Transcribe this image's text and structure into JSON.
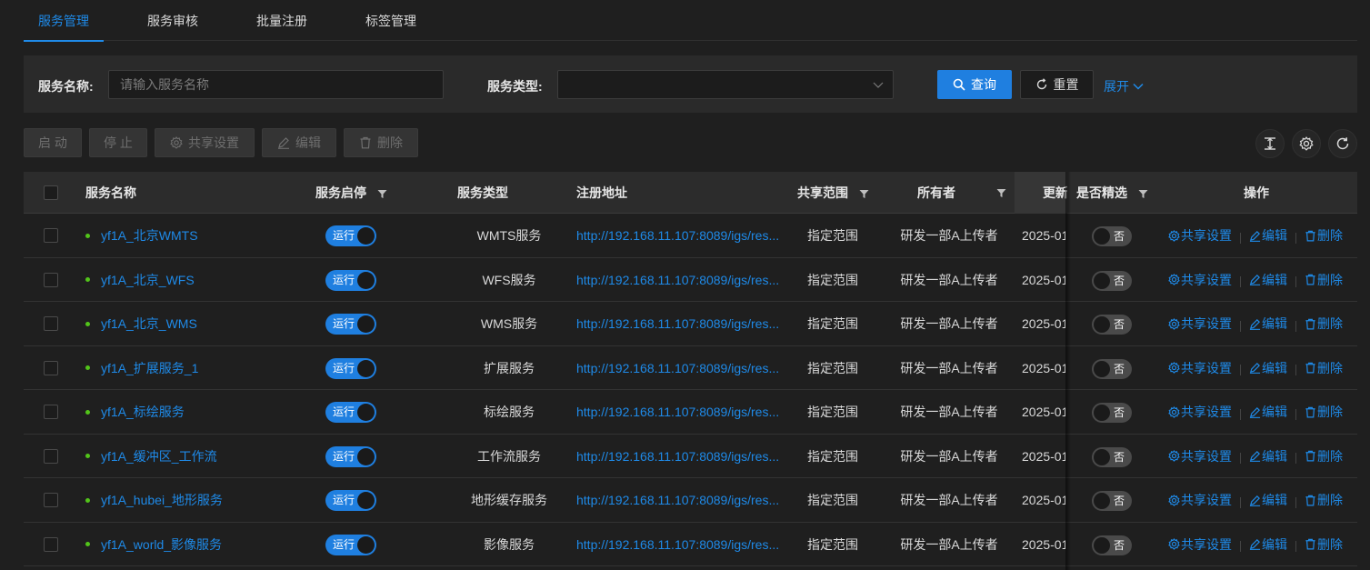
{
  "tabs": [
    {
      "label": "服务管理",
      "active": true
    },
    {
      "label": "服务审核",
      "active": false
    },
    {
      "label": "批量注册",
      "active": false
    },
    {
      "label": "标签管理",
      "active": false
    }
  ],
  "search": {
    "name_label": "服务名称:",
    "name_placeholder": "请输入服务名称",
    "type_label": "服务类型:",
    "type_value": "",
    "query_label": "查询",
    "reset_label": "重置",
    "expand_label": "展开"
  },
  "toolbar": {
    "start_label": "启 动",
    "stop_label": "停 止",
    "share_label": "共享设置",
    "edit_label": "编辑",
    "delete_label": "删除"
  },
  "table": {
    "columns": {
      "name": "服务名称",
      "status": "服务启停",
      "type": "服务类型",
      "url": "注册地址",
      "scope": "共享范围",
      "owner": "所有者",
      "updated": "更新",
      "featured": "是否精选",
      "actions": "操作"
    },
    "rows": [
      {
        "name": "yf1A_北京WMTS",
        "status": "运行",
        "type": "WMTS服务",
        "url": "http://192.168.11.107:8089/igs/res...",
        "scope": "指定范围",
        "owner": "研发一部A上传者",
        "updated": "2025-01",
        "featured": "否"
      },
      {
        "name": "yf1A_北京_WFS",
        "status": "运行",
        "type": "WFS服务",
        "url": "http://192.168.11.107:8089/igs/res...",
        "scope": "指定范围",
        "owner": "研发一部A上传者",
        "updated": "2025-01",
        "featured": "否"
      },
      {
        "name": "yf1A_北京_WMS",
        "status": "运行",
        "type": "WMS服务",
        "url": "http://192.168.11.107:8089/igs/res...",
        "scope": "指定范围",
        "owner": "研发一部A上传者",
        "updated": "2025-01",
        "featured": "否"
      },
      {
        "name": "yf1A_扩展服务_1",
        "status": "运行",
        "type": "扩展服务",
        "url": "http://192.168.11.107:8089/igs/res...",
        "scope": "指定范围",
        "owner": "研发一部A上传者",
        "updated": "2025-01",
        "featured": "否"
      },
      {
        "name": "yf1A_标绘服务",
        "status": "运行",
        "type": "标绘服务",
        "url": "http://192.168.11.107:8089/igs/res...",
        "scope": "指定范围",
        "owner": "研发一部A上传者",
        "updated": "2025-01",
        "featured": "否"
      },
      {
        "name": "yf1A_缓冲区_工作流",
        "status": "运行",
        "type": "工作流服务",
        "url": "http://192.168.11.107:8089/igs/res...",
        "scope": "指定范围",
        "owner": "研发一部A上传者",
        "updated": "2025-01",
        "featured": "否"
      },
      {
        "name": "yf1A_hubei_地形服务",
        "status": "运行",
        "type": "地形缓存服务",
        "url": "http://192.168.11.107:8089/igs/res...",
        "scope": "指定范围",
        "owner": "研发一部A上传者",
        "updated": "2025-01",
        "featured": "否"
      },
      {
        "name": "yf1A_world_影像服务",
        "status": "运行",
        "type": "影像服务",
        "url": "http://192.168.11.107:8089/igs/res...",
        "scope": "指定范围",
        "owner": "研发一部A上传者",
        "updated": "2025-01",
        "featured": "否"
      }
    ],
    "row_actions": {
      "share": "共享设置",
      "edit": "编辑",
      "delete": "删除"
    }
  },
  "colors": {
    "accent": "#1f8ae8",
    "running_dot": "#52c41a",
    "background": "#1f1f1f"
  }
}
